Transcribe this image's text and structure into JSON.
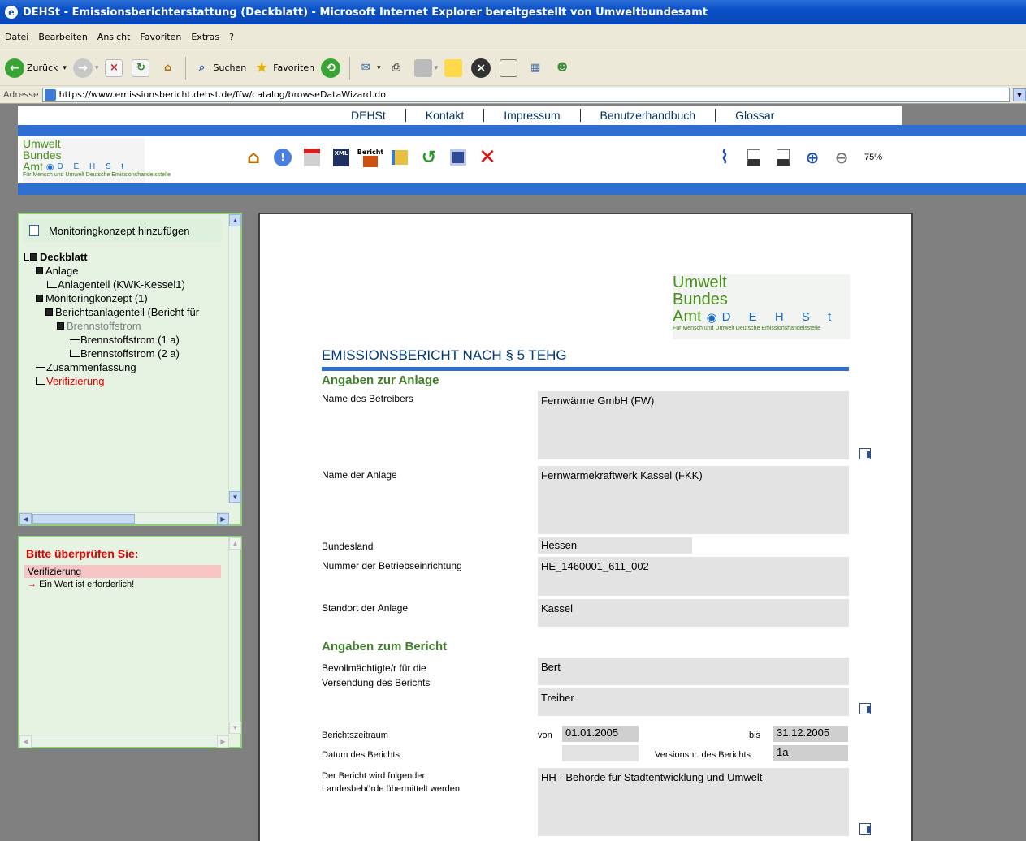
{
  "window": {
    "title": "DEHSt - Emissionsberichterstattung (Deckblatt) - Microsoft Internet Explorer bereitgestellt von Umweltbundesamt"
  },
  "menu": [
    "Datei",
    "Bearbeiten",
    "Ansicht",
    "Favoriten",
    "Extras",
    "?"
  ],
  "toolbar": {
    "back": "Zurück",
    "search": "Suchen",
    "favorites": "Favoriten"
  },
  "address": {
    "label": "Adresse",
    "url": "https://www.emissionsbericht.dehst.de/ffw/catalog/browseDataWizard.do"
  },
  "topnav": [
    "DEHSt",
    "Kontakt",
    "Impressum",
    "Benutzerhandbuch",
    "Glossar"
  ],
  "logo": {
    "line1": "Umwelt",
    "line2": "Bundes",
    "line3": "Amt",
    "dehst": "D E H S t",
    "sub": "Für Mensch und Umwelt   Deutsche Emissionshandelsstelle"
  },
  "header_icons": {
    "bericht": "Bericht",
    "zoom": "75%"
  },
  "tree": {
    "add": "Monitoringkonzept hinzufügen",
    "items": [
      {
        "label": "Deckblatt"
      },
      {
        "label": "Anlage"
      },
      {
        "label": "Anlagenteil (KWK-Kessel1)"
      },
      {
        "label": "Monitoringkonzept (1)"
      },
      {
        "label": "Berichtsanlagenteil (Bericht für"
      },
      {
        "label": "Brennstoffstrom"
      },
      {
        "label": "Brennstoffstrom (1 a)"
      },
      {
        "label": "Brennstoffstrom (2 a)"
      },
      {
        "label": "Zusammenfassung"
      },
      {
        "label": "Verifizierung"
      }
    ]
  },
  "messages": {
    "title": "Bitte überprüfen Sie:",
    "item": "Verifizierung",
    "text": "Ein Wert ist erforderlich!"
  },
  "doc": {
    "logo": {
      "l1": "Umwelt",
      "l2": "Bundes",
      "l3": "Amt",
      "dehst": "D E H S t",
      "sub": "Für Mensch und Umwelt   Deutsche Emissionshandelsstelle"
    },
    "title": "EMISSIONSBERICHT NACH § 5 TEHG",
    "section1": "Angaben zur Anlage",
    "betreiber_label": "Name des Betreibers",
    "betreiber_value": "Fernwärme GmbH (FW)",
    "anlage_label": "Name der Anlage",
    "anlage_value": "Fernwärmekraftwerk Kassel (FKK)",
    "bundesland_label": "Bundesland",
    "bundesland_value": "Hessen",
    "nummer_label": "Nummer der Betriebseinrichtung",
    "nummer_value": "HE_1460001_611_002",
    "standort_label": "Standort der Anlage",
    "standort_value": "Kassel",
    "section2": "Angaben zum Bericht",
    "bevoll_label_1": "Bevollmächtigte/r für die",
    "bevoll_label_2": "Versendung des Berichts",
    "vorname": "Bert",
    "nachname": "Treiber",
    "zeitraum_label": "Berichtszeitraum",
    "von_label": "von",
    "von_value": "01.01.2005",
    "bis_label": "bis",
    "bis_value": "31.12.2005",
    "datum_label": "Datum des Berichts",
    "datum_value": "",
    "version_label": "Versionsnr. des Berichts",
    "version_value": "1a",
    "behoerde_label_1": "Der Bericht wird folgender",
    "behoerde_label_2": "Landesbehörde übermittelt werden",
    "behoerde_value": "HH - Behörde für Stadtentwicklung und Umwelt"
  }
}
